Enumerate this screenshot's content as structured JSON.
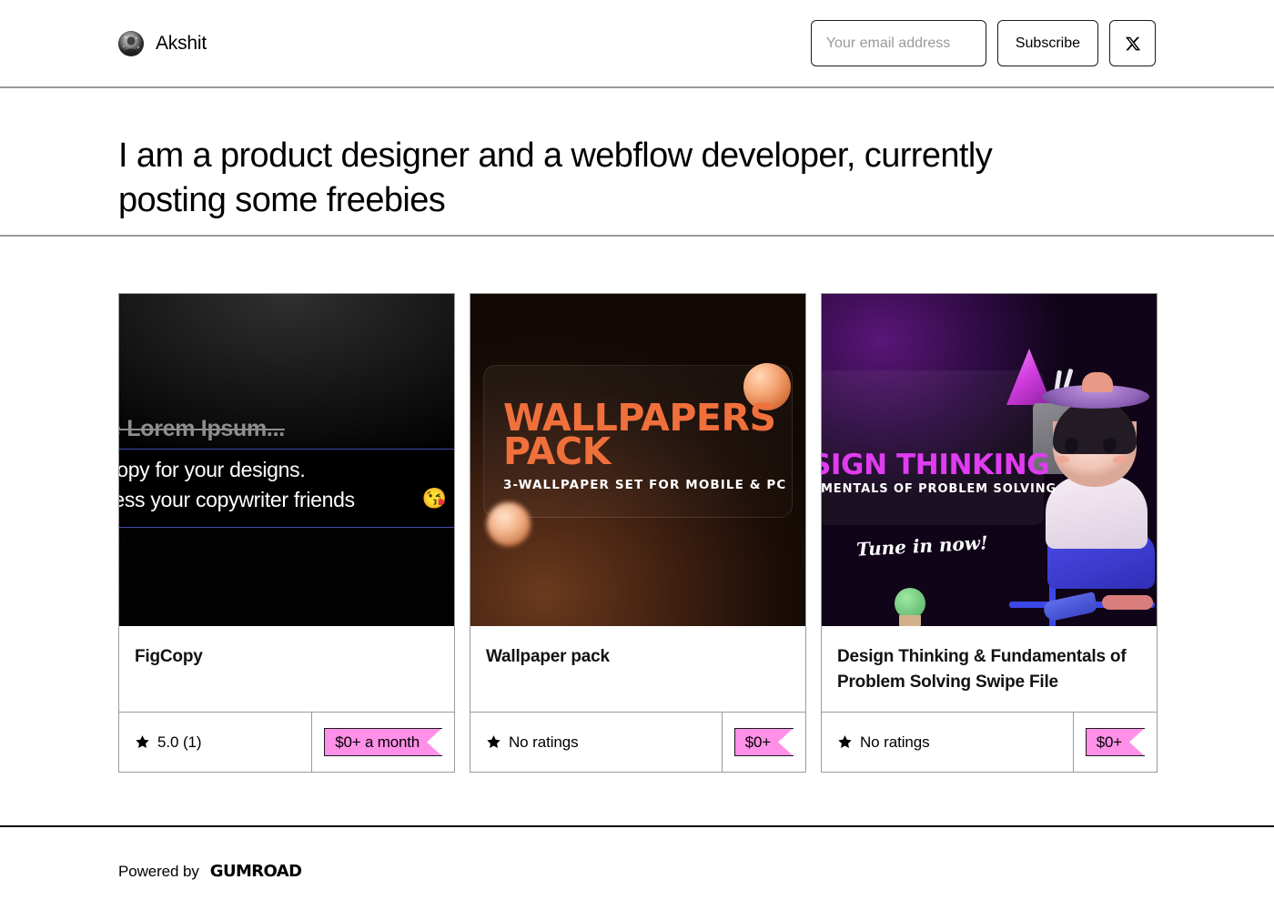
{
  "header": {
    "brand_name": "Akshit",
    "avatar_name": "creator-avatar",
    "email_placeholder": "Your email address",
    "email_value": "",
    "subscribe_label": "Subscribe",
    "social_icon": "x-twitter-icon"
  },
  "bio": {
    "text": "I am a product designer and a webflow developer, currently posting some freebies"
  },
  "products": [
    {
      "title": "FigCopy",
      "rating_text": "5.0 (1)",
      "price": "$0+ a month",
      "thumb": {
        "kind": "figcopy",
        "strike_text": "e Lorem Ipsum...",
        "line1": "copy for your designs.",
        "line2": "ress your copywriter friends",
        "emoji": "😘"
      }
    },
    {
      "title": "Wallpaper pack",
      "rating_text": "No ratings",
      "price": "$0+",
      "thumb": {
        "kind": "wallpapers",
        "title": "WALLPAPERS PACK",
        "subtitle": "3-WALLPAPER SET FOR MOBILE & PC"
      }
    },
    {
      "title": "Design Thinking & Fundamentals of Problem Solving Swipe File",
      "rating_text": "No ratings",
      "price": "$0+",
      "thumb": {
        "kind": "design-thinking",
        "title": "SIGN THINKING",
        "subtitle": "AMENTALS OF PROBLEM SOLVING",
        "script": "Tune in now!"
      }
    }
  ],
  "footer": {
    "powered_by": "Powered by",
    "brand": "Gumroad"
  },
  "colors": {
    "accent_pink": "#ff90e8",
    "wallpaper_orange": "#f0703c",
    "design_magenta": "#e03cf0",
    "border_gray": "#9b9b9b"
  }
}
